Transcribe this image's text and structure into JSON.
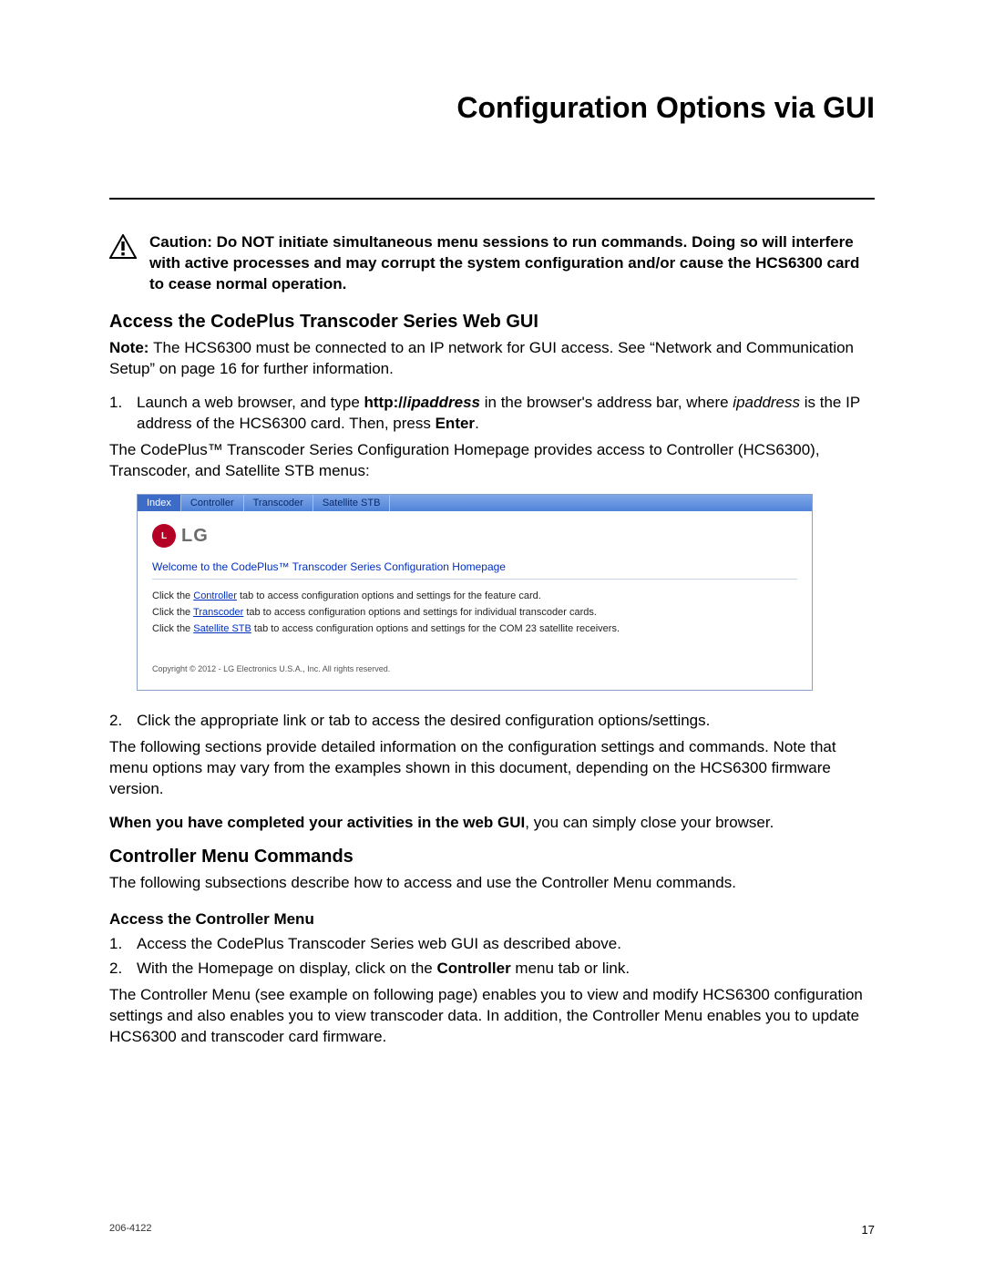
{
  "page_title": "Configuration Options via GUI",
  "caution": "Caution: Do NOT initiate simultaneous menu sessions to run commands. Doing so will interfere with active processes and may corrupt the system configuration and/or cause the HCS6300 card to cease normal operation.",
  "section1": {
    "heading": "Access the CodePlus Transcoder Series Web GUI",
    "note_label": "Note: ",
    "note_text": "The HCS6300 must be connected to an IP network for GUI access. See “Network and Communication Setup” on page 16 for further information.",
    "step1_num": "1.",
    "step1_a": "Launch a web browser, and type ",
    "step1_b_bold": "http://",
    "step1_b_italic": "ipaddress",
    "step1_c": " in the browser's address bar, where ",
    "step1_d_italic": "ipaddress",
    "step1_e": " is the IP address of the HCS6300 card. Then, press ",
    "step1_f_bold": "Enter",
    "step1_g": ".",
    "step1_follow": "The CodePlus™ Transcoder Series Configuration Homepage provides access to Controller (HCS6300), Transcoder, and Satellite STB menus:",
    "step2_num": "2.",
    "step2_text": "Click the appropriate link or tab to access the desired configuration options/settings.",
    "following_text": "The following sections provide detailed information on the configuration settings and commands. Note that menu options may vary from the examples shown in this document, depending on the HCS6300 firmware version.",
    "completed_bold": "When you have completed your activities in the web GUI",
    "completed_rest": ", you can simply close your browser."
  },
  "embedded": {
    "tabs": [
      "Index",
      "Controller",
      "Transcoder",
      "Satellite STB"
    ],
    "logo_text": "LG",
    "logo_glyph": "L",
    "welcome": "Welcome to the CodePlus™ Transcoder Series Configuration Homepage",
    "line1_a": "Click the ",
    "line1_link": "Controller",
    "line1_b": " tab to access configuration options and settings for the feature card.",
    "line2_a": "Click the ",
    "line2_link": "Transcoder",
    "line2_b": " tab to access configuration options and settings for individual transcoder cards.",
    "line3_a": "Click the ",
    "line3_link": "Satellite STB",
    "line3_b": " tab to access configuration options and settings for the COM 23 satellite receivers.",
    "copyright": "Copyright © 2012 - LG Electronics U.S.A., Inc. All rights reserved."
  },
  "section2": {
    "heading": "Controller Menu Commands",
    "intro": "The following subsections describe how to access and use the Controller Menu commands.",
    "sub_heading": "Access the Controller Menu",
    "s1_num": "1.",
    "s1_text": "Access the CodePlus Transcoder Series web GUI as described above.",
    "s2_num": "2.",
    "s2_a": "With the Homepage on display, click on the ",
    "s2_bold": "Controller",
    "s2_b": " menu tab or link.",
    "follow": "The Controller Menu (see example on following page) enables you to view and modify HCS6300 configuration settings and also enables you to view transcoder data. In addition, the Controller Menu enables you to update HCS6300 and transcoder card firmware."
  },
  "footer": {
    "doc": "206-4122",
    "page": "17"
  }
}
